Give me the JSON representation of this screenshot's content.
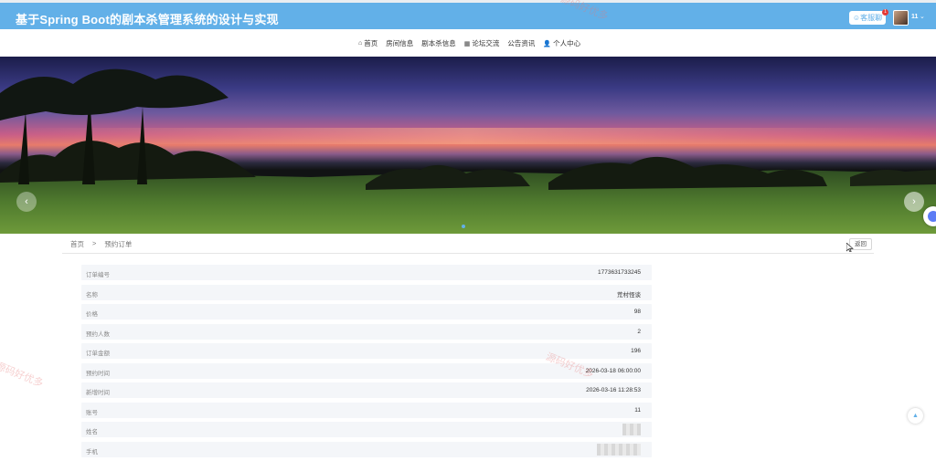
{
  "header": {
    "title": "基于Spring Boot的剧本杀管理系统的设计与实现",
    "support_label": "客服聊天",
    "badge_count": "1",
    "user_name": "11",
    "caret": "⌄"
  },
  "nav": {
    "items": [
      {
        "label": "首页",
        "icon": "home-icon"
      },
      {
        "label": "房间信息",
        "icon": ""
      },
      {
        "label": "剧本杀信息",
        "icon": ""
      },
      {
        "label": "论坛交流",
        "icon": "grid-icon"
      },
      {
        "label": "公告资讯",
        "icon": ""
      },
      {
        "label": "个人中心",
        "icon": "user-icon"
      }
    ]
  },
  "carousel": {
    "prev": "‹",
    "next": "›"
  },
  "breadcrumb": {
    "home": "首页",
    "separator": ">",
    "current": "预约订单"
  },
  "back_label": "返回",
  "order": {
    "rows": [
      {
        "label": "订单编号",
        "value": "1773631733245"
      },
      {
        "label": "名称",
        "value": "荒村怪谈"
      },
      {
        "label": "价格",
        "value": "98"
      },
      {
        "label": "预约人数",
        "value": "2"
      },
      {
        "label": "订单金额",
        "value": "196"
      },
      {
        "label": "预约时间",
        "value": "2026-03-18 06:00:00"
      },
      {
        "label": "新增时间",
        "value": "2026-03-16 11:28:53"
      },
      {
        "label": "账号",
        "value": "11"
      },
      {
        "label": "姓名",
        "value": ""
      },
      {
        "label": "手机",
        "value": ""
      }
    ]
  },
  "scroll_top": "▲",
  "watermark": "源码好优多",
  "colors": {
    "accent": "#62b0e8",
    "row_bg": "#f4f6f9"
  }
}
